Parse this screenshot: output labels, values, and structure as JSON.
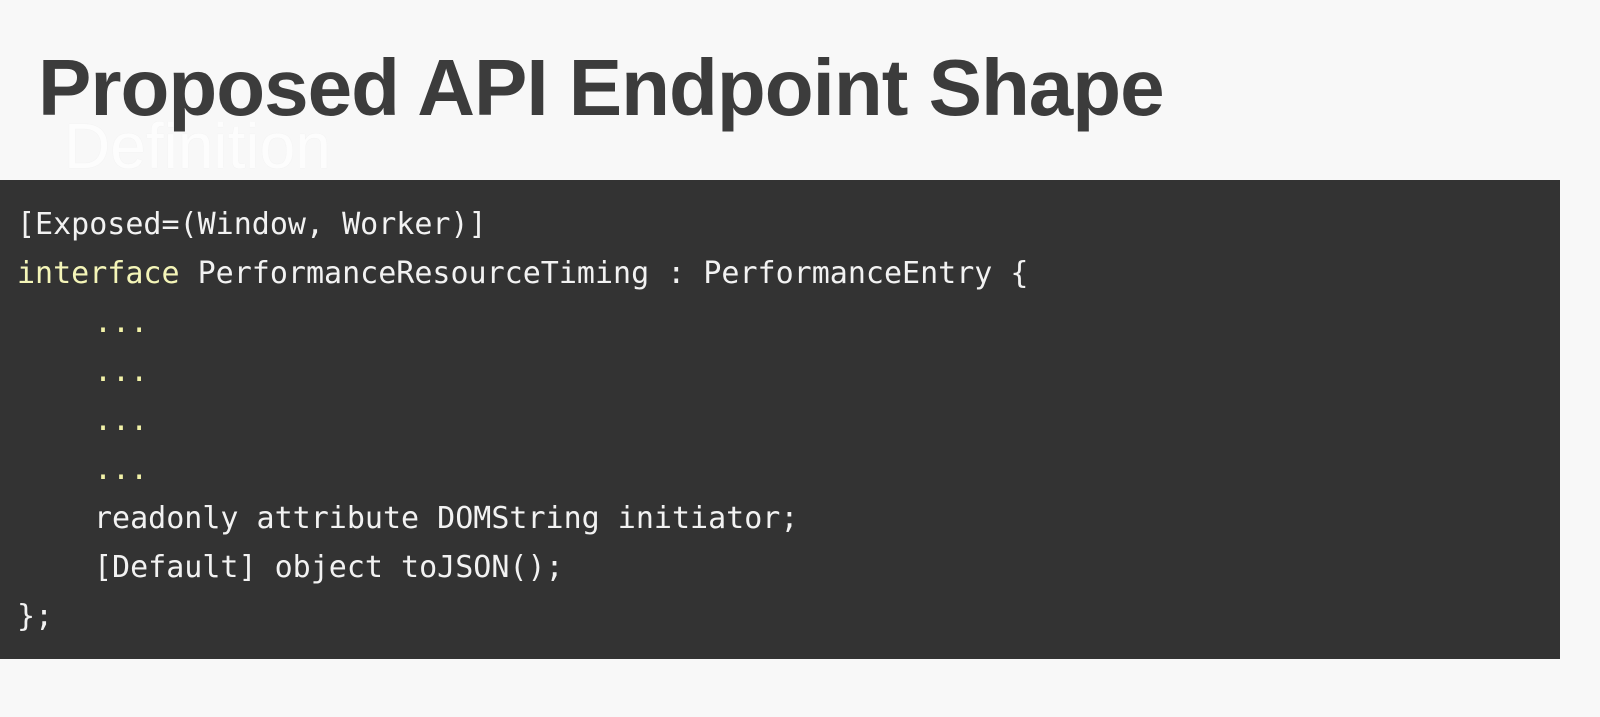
{
  "slide": {
    "title": "Proposed API Endpoint Shape",
    "ghost_subtitle": "Definition"
  },
  "code": {
    "line1": "[Exposed=(Window, Worker)]",
    "line2_keyword": "interface",
    "line2_rest": " PerformanceResourceTiming : PerformanceEntry {",
    "ellipsis_1": "...",
    "ellipsis_2": "...",
    "ellipsis_3": "...",
    "ellipsis_4": "...",
    "line7": "readonly attribute DOMString initiator;",
    "line8": "[Default] object toJSON();",
    "line9": "};"
  },
  "colors": {
    "background": "#f8f8f8",
    "title": "#3c3c3c",
    "code_background": "#333333",
    "code_text": "#f2f2f2",
    "keyword": "#f4f5b8"
  }
}
